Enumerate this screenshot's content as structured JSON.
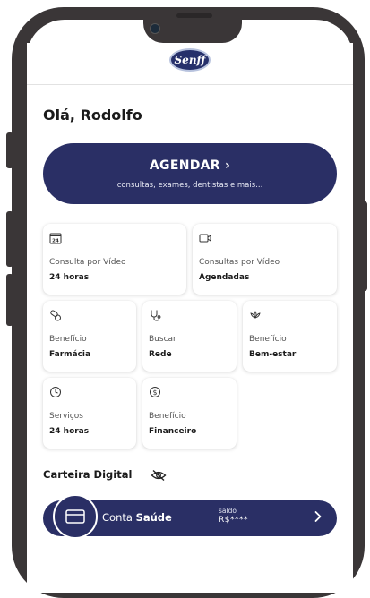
{
  "header": {
    "logo_text": "Senff"
  },
  "greeting": "Olá, Rodolfo",
  "agendar": {
    "title": "AGENDAR ›",
    "subtitle": "consultas, exames, dentistas e mais..."
  },
  "services": [
    {
      "icon": "24h-calendar-icon",
      "line1": "Consulta por Vídeo",
      "line2": "24 horas"
    },
    {
      "icon": "video-camera-icon",
      "line1": "Consultas por Vídeo",
      "line2": "Agendadas"
    },
    {
      "icon": "pills-icon",
      "line1": "Benefício",
      "line2": "Farmácia"
    },
    {
      "icon": "stethoscope-icon",
      "line1": "Buscar",
      "line2": "Rede"
    },
    {
      "icon": "lotus-icon",
      "line1": "Benefício",
      "line2": "Bem-estar"
    },
    {
      "icon": "clock-icon",
      "line1": "Serviços",
      "line2": "24 horas"
    },
    {
      "icon": "dollar-coin-icon",
      "line1": "Benefício",
      "line2": "Financeiro"
    }
  ],
  "wallet": {
    "title": "Carteira Digital",
    "account_prefix": "Conta ",
    "account_name": "Saúde",
    "balance_label": "saldo",
    "balance_value": "R$****"
  },
  "colors": {
    "brand_navy": "#2a2f65",
    "frame": "#3a3637"
  }
}
